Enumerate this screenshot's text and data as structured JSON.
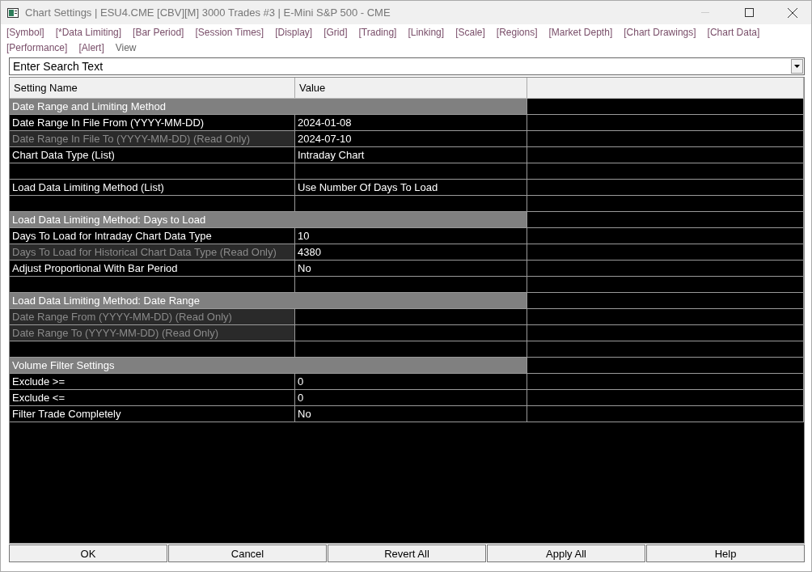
{
  "window": {
    "title": "Chart Settings | ESU4.CME [CBV][M]  3000 Trades #3 | E-Mini S&P 500 - CME"
  },
  "menu": [
    {
      "label": "[Symbol]",
      "kind": "tab"
    },
    {
      "label": "[*Data Limiting]",
      "kind": "tab"
    },
    {
      "label": "[Bar Period]",
      "kind": "tab"
    },
    {
      "label": "[Session Times]",
      "kind": "tab"
    },
    {
      "label": "[Display]",
      "kind": "tab"
    },
    {
      "label": "[Grid]",
      "kind": "tab"
    },
    {
      "label": "[Trading]",
      "kind": "tab"
    },
    {
      "label": "[Linking]",
      "kind": "tab"
    },
    {
      "label": "[Scale]",
      "kind": "tab"
    },
    {
      "label": "[Regions]",
      "kind": "tab"
    },
    {
      "label": "[Market Depth]",
      "kind": "tab"
    },
    {
      "label": "[Chart Drawings]",
      "kind": "tab"
    },
    {
      "label": "[Chart Data]",
      "kind": "tab"
    },
    {
      "label": "[Performance]",
      "kind": "tab"
    },
    {
      "label": "[Alert]",
      "kind": "tab"
    },
    {
      "label": "View",
      "kind": "menu"
    }
  ],
  "search": {
    "placeholder": "Enter Search Text"
  },
  "table": {
    "columns": [
      "Setting Name",
      "Value"
    ],
    "rows": [
      {
        "kind": "section",
        "name": "Date Range and Limiting Method"
      },
      {
        "kind": "setting",
        "name": "Date Range In File From (YYYY-MM-DD)",
        "value": "2024-01-08",
        "read_only": false
      },
      {
        "kind": "setting",
        "name": "Date Range In File To (YYYY-MM-DD) (Read Only)",
        "value": "2024-07-10",
        "read_only": true
      },
      {
        "kind": "setting",
        "name": "Chart Data Type (List)",
        "value": "Intraday Chart",
        "read_only": false
      },
      {
        "kind": "blank"
      },
      {
        "kind": "setting",
        "name": "Load Data Limiting Method (List)",
        "value": "Use Number Of Days To Load",
        "read_only": false
      },
      {
        "kind": "blank"
      },
      {
        "kind": "section",
        "name": "Load Data Limiting Method: Days to Load"
      },
      {
        "kind": "setting",
        "name": "Days To Load for Intraday Chart Data Type",
        "value": "10",
        "read_only": false
      },
      {
        "kind": "setting",
        "name": "Days To Load for Historical Chart Data Type (Read Only)",
        "value": "4380",
        "read_only": true
      },
      {
        "kind": "setting",
        "name": "Adjust Proportional With Bar Period",
        "value": "No",
        "read_only": false
      },
      {
        "kind": "blank"
      },
      {
        "kind": "section",
        "name": "Load Data Limiting Method: Date Range"
      },
      {
        "kind": "setting",
        "name": "Date Range From (YYYY-MM-DD) (Read Only)",
        "read_only": true
      },
      {
        "kind": "setting",
        "name": "Date Range To (YYYY-MM-DD) (Read Only)",
        "read_only": true
      },
      {
        "kind": "blank"
      },
      {
        "kind": "section",
        "name": "Volume Filter Settings"
      },
      {
        "kind": "setting",
        "name": "Exclude >=",
        "value": "0",
        "read_only": false
      },
      {
        "kind": "setting",
        "name": "Exclude <=",
        "value": "0",
        "read_only": false
      },
      {
        "kind": "setting",
        "name": "Filter Trade Completely",
        "value": "No",
        "read_only": false
      }
    ]
  },
  "buttons": [
    "OK",
    "Cancel",
    "Revert All",
    "Apply All",
    "Help"
  ]
}
